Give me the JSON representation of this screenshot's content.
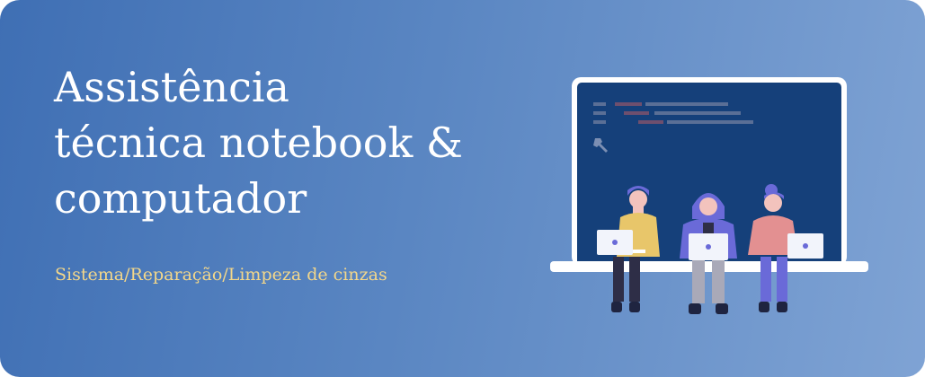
{
  "banner": {
    "title_lines": [
      "Assistência",
      "técnica notebook &",
      "computador"
    ],
    "subtitle": "Sistema/Reparação/Limpeza de cinzas"
  },
  "colors": {
    "gradient_start": "#3f6fb4",
    "gradient_end": "#7fa3d4",
    "title": "#ffffff",
    "subtitle": "#f3d78a",
    "screen": "#15407a"
  },
  "illustration": {
    "icons": [
      "laptop-screen",
      "wrench-icon",
      "person-with-laptop",
      "person-with-laptop",
      "person-with-laptop"
    ]
  }
}
